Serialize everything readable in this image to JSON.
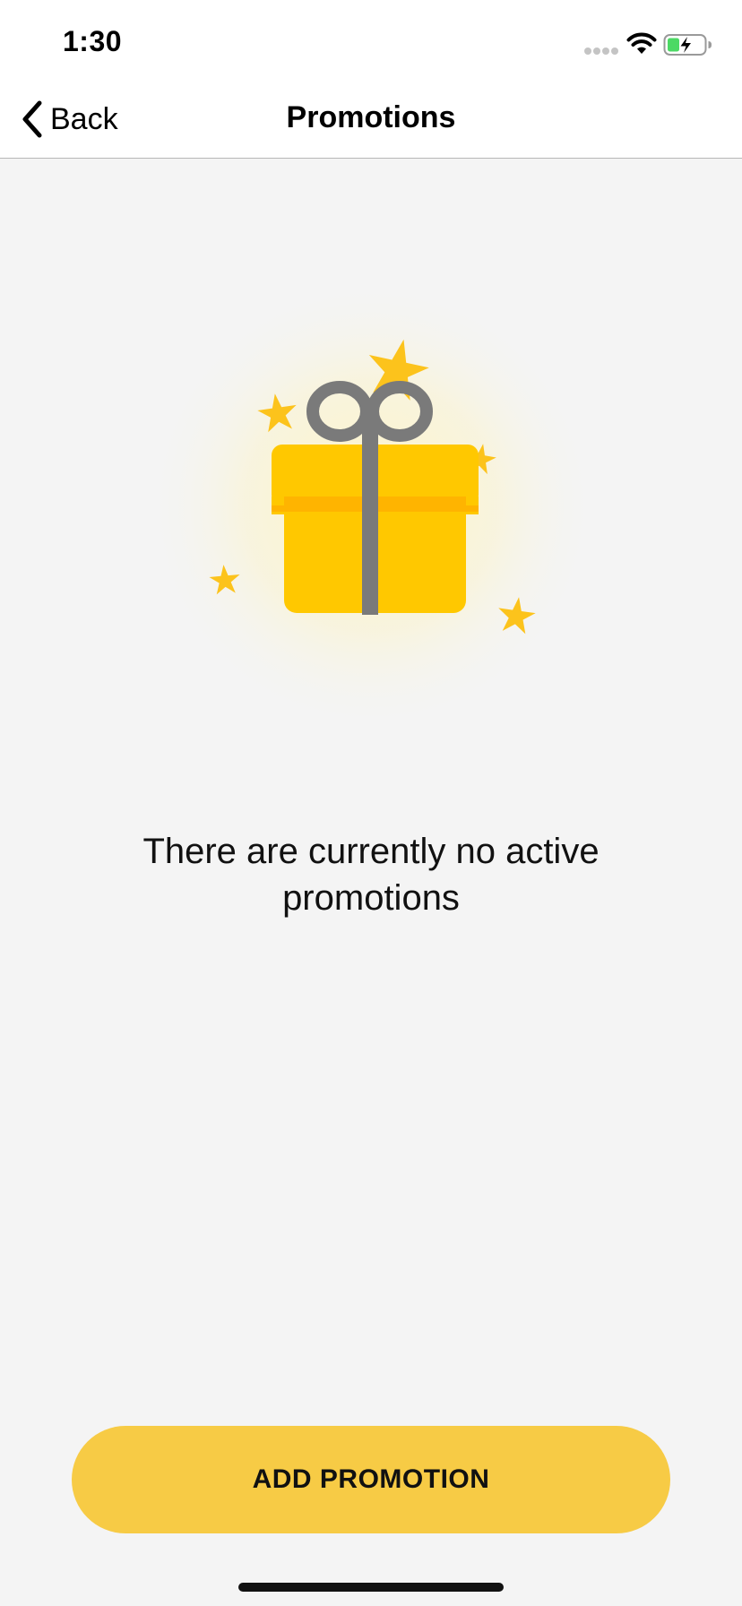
{
  "status_bar": {
    "time": "1:30",
    "icons": [
      "signal-dots-icon",
      "wifi-icon",
      "battery-charging-icon"
    ],
    "battery_color": "#4cd964"
  },
  "nav": {
    "back_label": "Back",
    "title": "Promotions"
  },
  "illustration": {
    "icon": "gift-icon",
    "decorations": "star-icon",
    "box_color": "#ffc800",
    "box_band_color": "#ffb400",
    "ribbon_color": "#7a7a7a",
    "star_color": "#fcc31c"
  },
  "empty_state": {
    "message": "There are currently no active promotions"
  },
  "actions": {
    "add_promotion_label": "ADD PROMOTION",
    "accent_color": "#f7cb45"
  }
}
